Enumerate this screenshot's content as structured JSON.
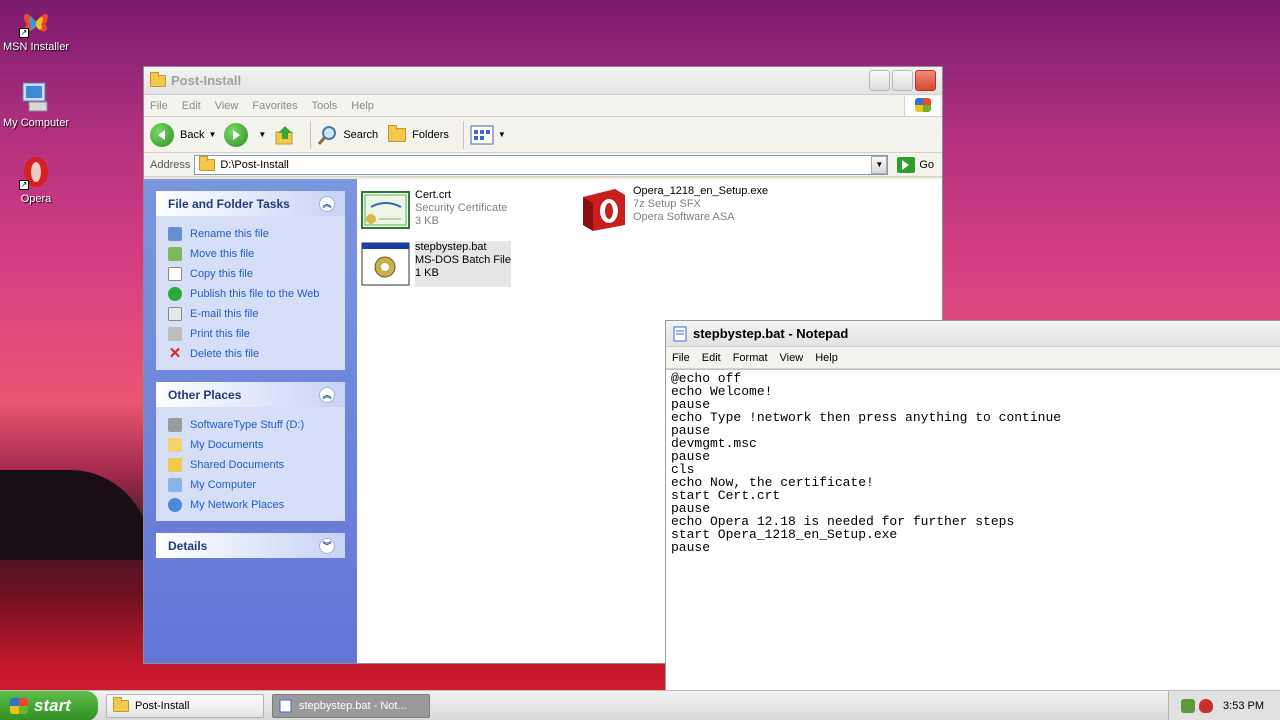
{
  "desktop": {
    "icons": [
      {
        "label": "MSN Installer",
        "icon": "msn-butterfly-icon"
      },
      {
        "label": "My Computer",
        "icon": "computer-icon"
      },
      {
        "label": "Opera",
        "icon": "opera-icon"
      }
    ]
  },
  "explorer": {
    "title": "Post-Install",
    "menu": [
      "File",
      "Edit",
      "View",
      "Favorites",
      "Tools",
      "Help"
    ],
    "toolbar": {
      "back": "Back",
      "search": "Search",
      "folders": "Folders"
    },
    "address": {
      "label": "Address",
      "value": "D:\\Post-Install",
      "go": "Go"
    },
    "tasks_panel": {
      "title": "File and Folder Tasks",
      "items": [
        "Rename this file",
        "Move this file",
        "Copy this file",
        "Publish this file to the Web",
        "E-mail this file",
        "Print this file",
        "Delete this file"
      ]
    },
    "places_panel": {
      "title": "Other Places",
      "items": [
        "SoftwareType Stuff (D:)",
        "My Documents",
        "Shared Documents",
        "My Computer",
        "My Network Places"
      ]
    },
    "details_panel": {
      "title": "Details"
    },
    "files": [
      {
        "name": "Cert.crt",
        "type": "Security Certificate",
        "size": "3 KB"
      },
      {
        "name": "Opera_1218_en_Setup.exe",
        "type": "7z Setup SFX",
        "size": "Opera Software ASA"
      },
      {
        "name": "stepbystep.bat",
        "type": "MS-DOS Batch File",
        "size": "1 KB"
      }
    ]
  },
  "notepad": {
    "title": "stepbystep.bat - Notepad",
    "menu": [
      "File",
      "Edit",
      "Format",
      "View",
      "Help"
    ],
    "content": "@echo off\necho Welcome!\npause\necho Type !network then press anything to continue\npause\ndevmgmt.msc\npause\ncls\necho Now, the certificate!\nstart Cert.crt\npause\necho Opera 12.18 is needed for further steps\nstart Opera_1218_en_Setup.exe\npause"
  },
  "taskbar": {
    "start": "start",
    "tasks": [
      "Post-Install",
      "stepbystep.bat - Not..."
    ],
    "clock": "3:53 PM"
  },
  "colors": {
    "accent": "#215dc6",
    "start_green": "#2f8f21",
    "task_blue": "#215dc6"
  }
}
